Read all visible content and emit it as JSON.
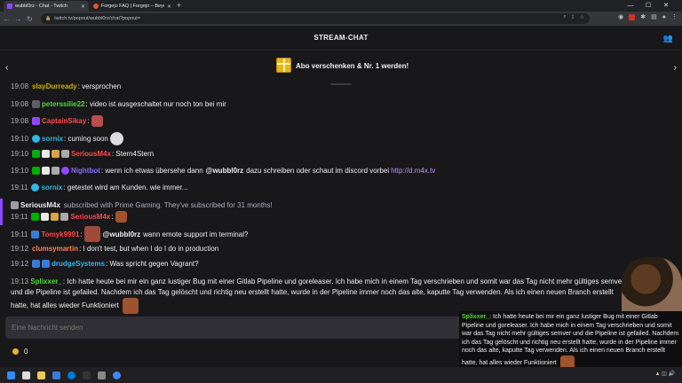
{
  "browser": {
    "tabs": [
      {
        "title": "wubbl0rz - Chat - Twitch",
        "favicon_color": "#9147ff",
        "active": true
      },
      {
        "title": "Forgejo FAQ | Forgejo – Beyond",
        "favicon_color": "#e8542b",
        "active": false
      }
    ],
    "url": "twitch.tv/popout/wubbl0rz/chat?popout="
  },
  "chat": {
    "title": "STREAM-CHAT",
    "banner": {
      "text": "Abo verschenken & Nr. 1 werden!"
    },
    "messages": [
      {
        "time": "19:08",
        "user": "peterssilie22",
        "color": "#59d33f",
        "text": ": video ist ausgeschaltet nur noch ton bei mir"
      },
      {
        "time": "19:08",
        "user": "CaptainSikay",
        "color": "#ff4949",
        "text": ":"
      },
      {
        "time": "19:10",
        "user": "sornix",
        "color": "#33b5e5",
        "text": ": cuming soon"
      },
      {
        "time": "19:10",
        "user": "SeriousM4x",
        "color": "#ff4949",
        "text": ": Stern4Stern"
      },
      {
        "time": "19:10",
        "user": "Nightbot",
        "color": "#8a6cff",
        "text": ": wenn ich etwas übersehe dann",
        "mention": "@wubbl0rz",
        "text2": "dazu schreiben oder schaut im discord vorbei",
        "link": "http://d.m4x.tv"
      },
      {
        "time": "19:11",
        "user": "sornix",
        "color": "#33b5e5",
        "text": ": getestet wird am Kunden. wie immer..."
      },
      {
        "time": "19:11",
        "user": "SeriousM4x",
        "color": "#ff4949",
        "text": ":"
      },
      {
        "time": "19:11",
        "user": "Tomyk9991",
        "color": "#ff4949",
        "text": ":",
        "mention": "@wubbl0rz",
        "text2": "wann emote support im terminal?"
      },
      {
        "time": "19:12",
        "user": "clumsymartin",
        "color": "#ff7f50",
        "text": ": I don't test, but when I do I do in production"
      },
      {
        "time": "19:12",
        "user": "drudgeSystems",
        "color": "#33b5e5",
        "text": ": Was spricht gegen Vagrant?"
      },
      {
        "time": "19:13",
        "user": "Splixxer_",
        "color": "#59d33f",
        "text": ": Ich hatte heute bei mir ein ganz lustiger Bug mit einer Gitlab Pipeline und goreleaser. Ich habe mich in einem Tag verschrieben und somit war das Tag nicht mehr gültiges semver und die Pipeline ist gefailed. Nachdem ich das Tag gelöscht und richtig neu erstellt hatte, wurde in der Pipeline immer noch das alte, kaputte Tag verwenden. Als ich einen neuen Branch erstellt hatte, hat alles wieder Funktioniert"
      }
    ],
    "top_partial": {
      "time": "19:08",
      "user": "slayDurready",
      "text": ": versprochen"
    },
    "subscription": {
      "user": "SeriousM4x",
      "text": "subscribed with Prime Gaming. They've subscribed for 31 months!"
    },
    "composer": {
      "placeholder": "Eine Nachricht senden"
    },
    "points": {
      "value": "0"
    }
  },
  "overlay": {
    "user": "Splixxer_",
    "text": ": Ich hatte heute bei mir ein ganz lustiger Bug mit einer Gitlab Pipeline und goreleaser. Ich habe mich in einem Tag verschrieben und somit war das Tag nicht mehr gültiges semver und die Pipeline ist gefailed. Nachdem ich das Tag gelöscht und richtig neu erstellt hatte, wurde in der Pipeline immer noch das alte, kaputte Tag verwenden. Als ich einen neuen Branch erstellt hatte, hat alles wieder Funktioniert"
  },
  "icons": [
    "chevron-left-icon",
    "chevron-right-icon",
    "gift-icon",
    "user-list-icon",
    "prime-badge-icon",
    "sub-badge-icon",
    "bits-badge-icon",
    "verified-badge-icon",
    "points-icon"
  ]
}
